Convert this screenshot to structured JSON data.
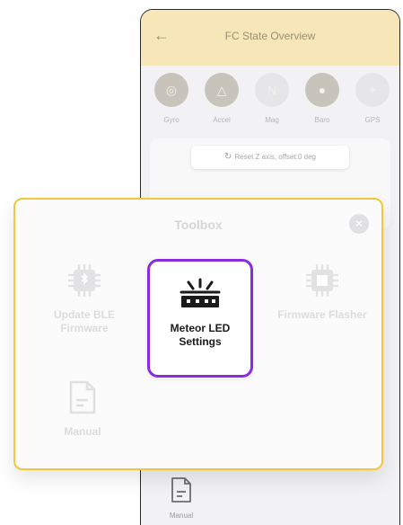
{
  "screen": {
    "back_icon": "arrow-left-icon",
    "title": "FC State Overview",
    "sensors": [
      {
        "label": "Gyro",
        "icon": "gyro-icon",
        "active": true
      },
      {
        "label": "Accel",
        "icon": "accel-icon",
        "active": true
      },
      {
        "label": "Mag",
        "icon": "mag-icon",
        "active": false
      },
      {
        "label": "Baro",
        "icon": "thermometer-icon",
        "active": true
      },
      {
        "label": "GPS",
        "icon": "satellite-icon",
        "active": false
      }
    ],
    "reset_button": "Reset Z axis, offset:0 deg",
    "manual_label": "Manual"
  },
  "toolbox": {
    "title": "Toolbox",
    "close_icon": "close-icon",
    "items": {
      "ble": {
        "label_line1": "Update BLE",
        "label_line2": "Firmware",
        "icon": "bluetooth-chip-icon"
      },
      "meteor": {
        "label_line1": "Meteor LED",
        "label_line2": "Settings",
        "icon": "led-strip-icon"
      },
      "flasher": {
        "label": "Firmware Flasher",
        "icon": "chip-icon"
      },
      "manual": {
        "label": "Manual",
        "icon": "document-icon"
      }
    }
  },
  "colors": {
    "header_bg": "#f7e7b8",
    "modal_border": "#f4c63a",
    "highlight": "#8a2be2"
  }
}
